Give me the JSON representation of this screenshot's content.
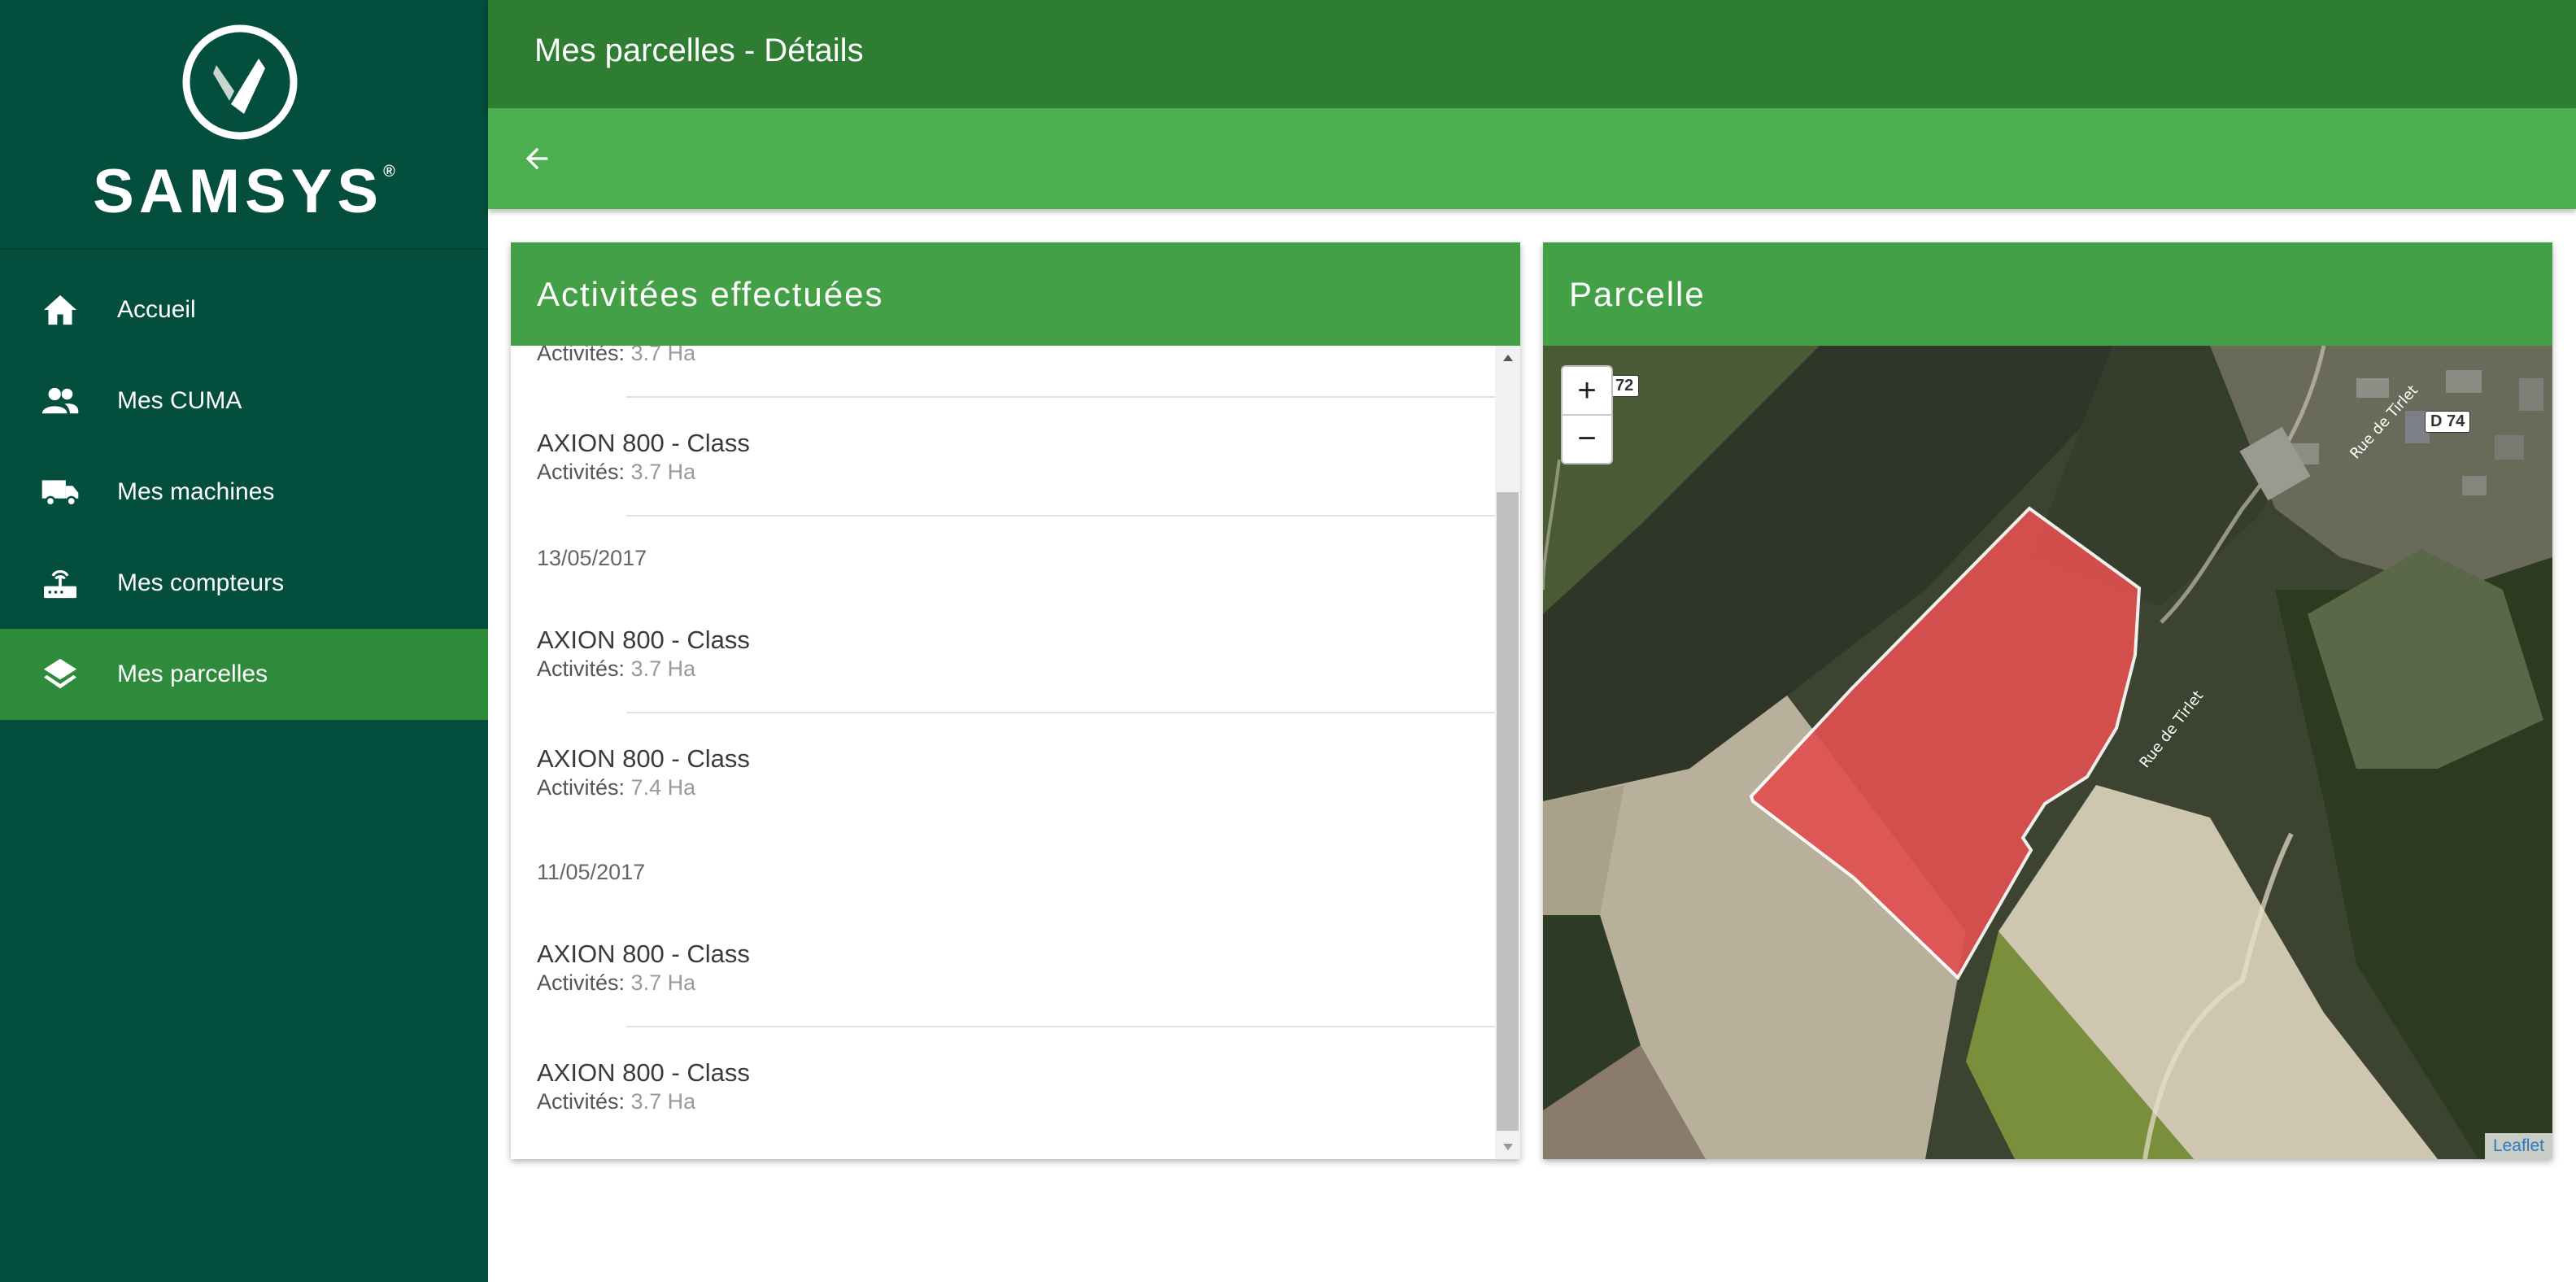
{
  "brand": {
    "name": "SAMSYS",
    "reg": "®"
  },
  "nav": [
    {
      "label": "Accueil",
      "icon": "home-icon",
      "active": false
    },
    {
      "label": "Mes CUMA",
      "icon": "group-icon",
      "active": false
    },
    {
      "label": "Mes machines",
      "icon": "truck-icon",
      "active": false
    },
    {
      "label": "Mes compteurs",
      "icon": "router-icon",
      "active": false
    },
    {
      "label": "Mes parcelles",
      "icon": "layers-icon",
      "active": true
    }
  ],
  "header": {
    "title": "Mes parcelles - Détails"
  },
  "activities": {
    "title": "Activitées effectuées",
    "sub_key": "Activités:",
    "partial_top": {
      "sub_value": "3.7 Ha"
    },
    "groups": [
      {
        "machine": "AXION 800 - Class",
        "value": "3.7 Ha"
      },
      {
        "date": "13/05/2017"
      },
      {
        "machine": "AXION 800 - Class",
        "value": "3.7 Ha"
      },
      {
        "machine": "AXION 800 - Class",
        "value": "7.4 Ha"
      },
      {
        "date": "11/05/2017"
      },
      {
        "machine": "AXION 800 - Class",
        "value": "3.7 Ha"
      },
      {
        "machine": "AXION 800 - Class",
        "value": "3.7 Ha"
      }
    ]
  },
  "parcel": {
    "title": "Parcelle",
    "zoom_in": "+",
    "zoom_out": "−",
    "attribution": "Leaflet",
    "road_labels": [
      "72",
      "D 74"
    ],
    "street_labels": [
      "Rue de Tirlet",
      "Rue de Tirlet"
    ],
    "polygon_color": "#e05050"
  },
  "colors": {
    "sidebar": "#034e3c",
    "active_nav": "#2e8b3c",
    "topbar": "#2f7d33",
    "subbar": "#4caf50",
    "card_header": "#43a047"
  }
}
